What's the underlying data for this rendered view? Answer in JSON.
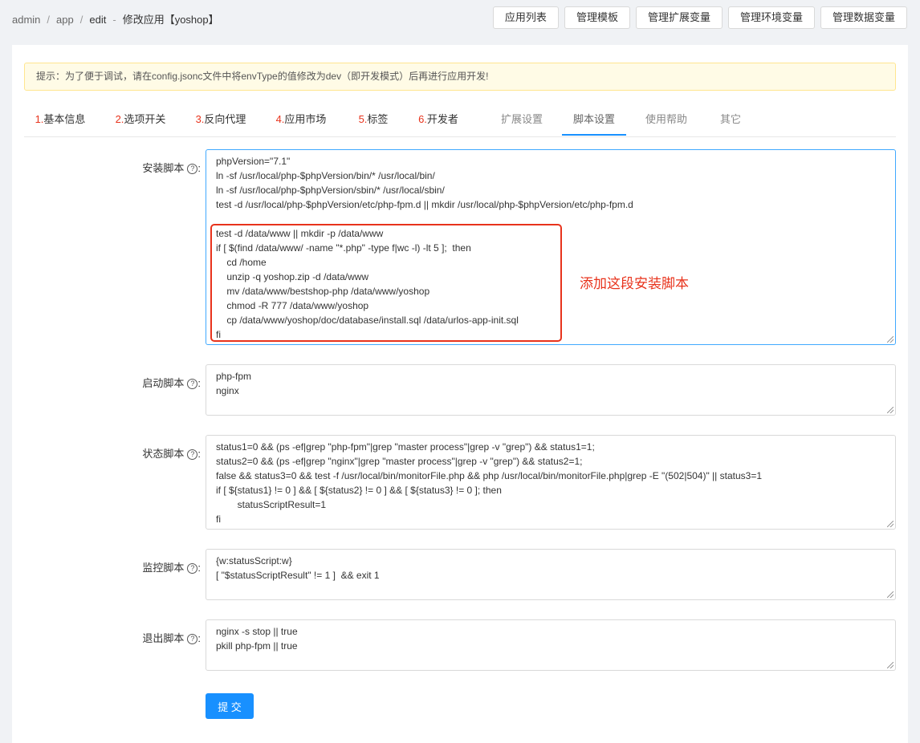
{
  "breadcrumb": {
    "items": [
      "admin",
      "app",
      "edit"
    ],
    "separator": "/",
    "title_sep": "-",
    "title": "修改应用【yoshop】"
  },
  "top_buttons": [
    "应用列表",
    "管理模板",
    "管理扩展变量",
    "管理环境变量",
    "管理数据变量"
  ],
  "notice": "提示：为了便于调试，请在config.jsonc文件中将envType的值修改为dev（即开发模式）后再进行应用开发!",
  "tabs": [
    {
      "num": "1.",
      "label": "基本信息"
    },
    {
      "num": "2.",
      "label": "选项开关"
    },
    {
      "num": "3.",
      "label": "反向代理"
    },
    {
      "num": "4.",
      "label": "应用市场"
    },
    {
      "num": "5.",
      "label": "标签"
    },
    {
      "num": "6.",
      "label": "开发者"
    },
    {
      "num": "",
      "label": "扩展设置"
    },
    {
      "num": "",
      "label": "脚本设置"
    },
    {
      "num": "",
      "label": "使用帮助"
    },
    {
      "num": "",
      "label": "其它"
    }
  ],
  "help_glyph": "?",
  "fields": {
    "install": {
      "label": "安装脚本",
      "value": "phpVersion=\"7.1\"\nln -sf /usr/local/php-$phpVersion/bin/* /usr/local/bin/\nln -sf /usr/local/php-$phpVersion/sbin/* /usr/local/sbin/\ntest -d /usr/local/php-$phpVersion/etc/php-fpm.d || mkdir /usr/local/php-$phpVersion/etc/php-fpm.d\n\ntest -d /data/www || mkdir -p /data/www\nif [ $(find /data/www/ -name \"*.php\" -type f|wc -l) -lt 5 ];  then\n    cd /home\n    unzip -q yoshop.zip -d /data/www\n    mv /data/www/bestshop-php /data/www/yoshop\n    chmod -R 777 /data/www/yoshop\n    cp /data/www/yoshop/doc/database/install.sql /data/urlos-app-init.sql\nfi"
    },
    "start": {
      "label": "启动脚本",
      "value": "php-fpm\nnginx"
    },
    "status": {
      "label": "状态脚本",
      "value": "status1=0 && (ps -ef|grep \"php-fpm\"|grep \"master process\"|grep -v \"grep\") && status1=1;\nstatus2=0 && (ps -ef|grep \"nginx\"|grep \"master process\"|grep -v \"grep\") && status2=1;\nfalse && status3=0 && test -f /usr/local/bin/monitorFile.php && php /usr/local/bin/monitorFile.php|grep -E \"(502|504)\" || status3=1\nif [ ${status1} != 0 ] && [ ${status2} != 0 ] && [ ${status3} != 0 ]; then\n        statusScriptResult=1\nfi"
    },
    "monitor": {
      "label": "监控脚本",
      "value": "{w:statusScript:w}\n[ \"$statusScriptResult\" != 1 ]  && exit 1"
    },
    "exit": {
      "label": "退出脚本",
      "value": "nginx -s stop || true\npkill php-fpm || true"
    }
  },
  "label_colon": ":",
  "annotation": "添加这段安装脚本",
  "submit_label": "提 交",
  "colors": {
    "accent": "#1890ff",
    "highlight": "#e8331c",
    "notice_bg": "#fffbe6"
  }
}
